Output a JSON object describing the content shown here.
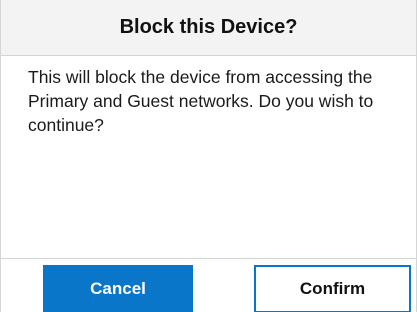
{
  "dialog": {
    "title": "Block this Device?",
    "message": "This will block the device from accessing the Primary and Guest networks. Do you wish to continue?",
    "cancel_label": "Cancel",
    "confirm_label": "Confirm"
  },
  "colors": {
    "primary_blue": "#0a76c9",
    "header_bg": "#f3f3f3",
    "text": "#111111"
  }
}
